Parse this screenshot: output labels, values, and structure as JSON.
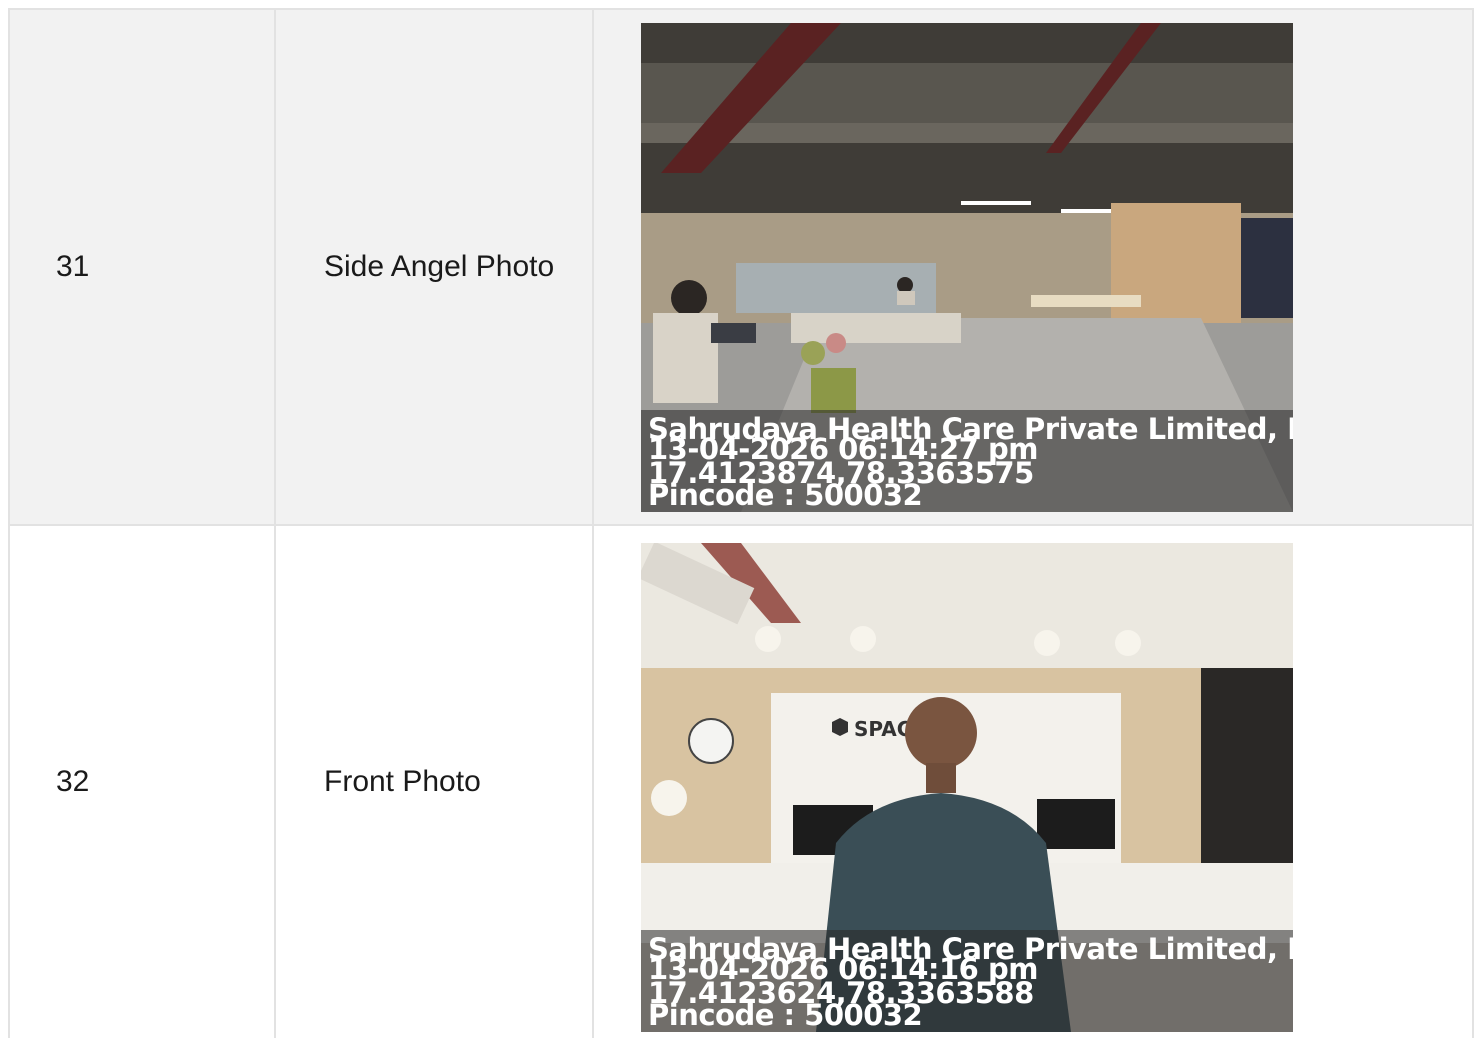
{
  "rows": [
    {
      "number": "31",
      "label": "Side Angel Photo",
      "photo": {
        "subject": "office-lounge-photo",
        "stamp": {
          "company": "Sahrudaya Health Care Private Limited, Fir",
          "datetime": "13-04-2026 06:14:27 pm",
          "coordinates": "17.4123874,78.3363575",
          "pincode": "Pincode : 500032"
        }
      }
    },
    {
      "number": "32",
      "label": "Front Photo",
      "photo": {
        "subject": "reception-front-photo",
        "sign_text": "SPAC",
        "stamp": {
          "company": "Sahrudaya Health Care Private Limited, Fir",
          "datetime": "13-04-2026 06:14:16 pm",
          "coordinates": "17.4123624,78.3363588",
          "pincode": "Pincode : 500032"
        }
      }
    }
  ],
  "colors": {
    "border": "#e2e2e2",
    "alt_row": "#f2f2f2",
    "text": "#1a1a1a",
    "stamp_text": "#ffffff"
  }
}
